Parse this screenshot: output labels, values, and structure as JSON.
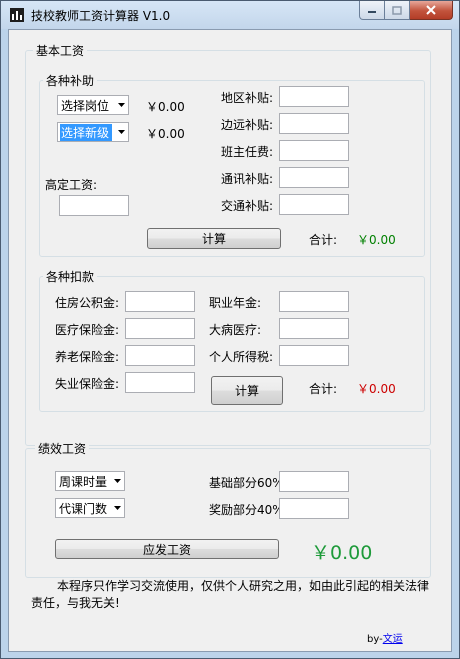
{
  "window": {
    "title": "技校教师工资计算器 V1.0"
  },
  "basic_salary": {
    "group_title": "基本工资",
    "allowances": {
      "group_title": "各种补助",
      "position_select": {
        "value": "选择岗位",
        "amount": "￥0.00"
      },
      "title_select": {
        "value": "选择新级",
        "amount": "￥0.00"
      },
      "fixed_salary_label": "高定工资:",
      "fixed_salary_value": "",
      "region_label": "地区补贴:",
      "remote_label": "边远补贴:",
      "class_teacher_label": "班主任费:",
      "comm_label": "通讯补贴:",
      "transport_label": "交通补贴:",
      "calc_button": "计算",
      "total_label": "合计:",
      "total_value": "￥0.00"
    },
    "deductions": {
      "group_title": "各种扣款",
      "housing_label": "住房公积金:",
      "medical_label": "医疗保险金:",
      "pension_label": "养老保险金:",
      "unemployment_label": "失业保险金:",
      "annuity_label": "职业年金:",
      "serious_illness_label": "大病医疗:",
      "income_tax_label": "个人所得税:",
      "calc_button": "计算",
      "total_label": "合计:",
      "total_value": "￥0.00"
    }
  },
  "performance": {
    "group_title": "绩效工资",
    "weekly_hours_select": "周课时量",
    "substitute_select": "代课门数",
    "base_part_label": "基础部分60%",
    "bonus_part_label": "奖励部分40%",
    "payable_button": "应发工资",
    "payable_value": "￥0.00"
  },
  "footer": {
    "note": "本程序只作学习交流使用，仅供个人研究之用，如由此引起的相关法律责任，与我无关!",
    "by_label": "by-",
    "author_link": "文运"
  },
  "colors": {
    "total_allowance": "#008000",
    "total_deduction": "#cc0000",
    "payable": "#1e9a3a"
  }
}
